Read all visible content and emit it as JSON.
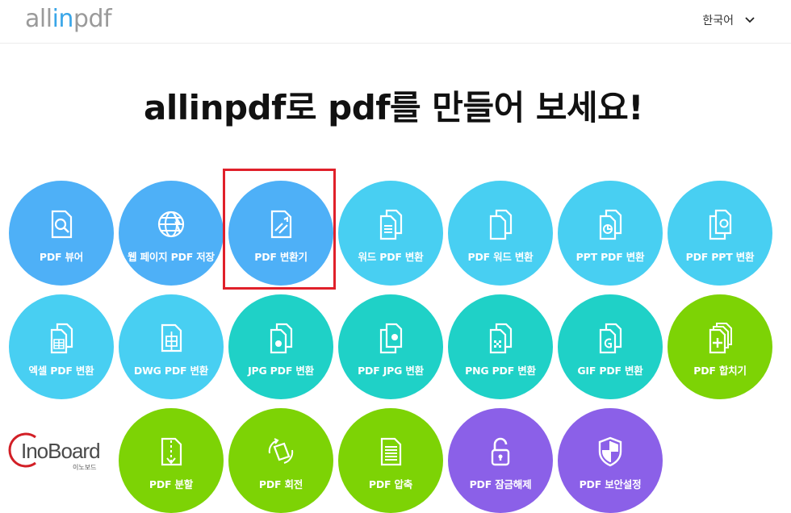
{
  "header": {
    "logo_prefix": "all",
    "logo_highlight": "in",
    "logo_suffix": "pdf",
    "language": "한국어",
    "language_icon": "chevron-down-icon"
  },
  "headline": "allinpdf로 pdf를 만들어 보세요!",
  "tools": [
    {
      "label": "PDF 뷰어",
      "icon": "pdf-viewer-icon",
      "color": "#4eb0f7"
    },
    {
      "label": "웹 페이지 PDF 저장",
      "icon": "globe-icon",
      "color": "#4eb0f7"
    },
    {
      "label": "PDF 변환기",
      "icon": "pdf-convert-icon",
      "color": "#4eb0f7"
    },
    {
      "label": "워드 PDF 변환",
      "icon": "word-doc-icon",
      "color": "#48cff2"
    },
    {
      "label": "PDF 워드 변환",
      "icon": "pdf-to-word-icon",
      "color": "#48cff2"
    },
    {
      "label": "PPT PDF 변환",
      "icon": "ppt-icon",
      "color": "#48cff2"
    },
    {
      "label": "PDF PPT 변환",
      "icon": "pdf-to-ppt-icon",
      "color": "#48cff2"
    },
    {
      "label": "엑셀 PDF 변환",
      "icon": "excel-icon",
      "color": "#48cff2"
    },
    {
      "label": "DWG PDF 변환",
      "icon": "dwg-icon",
      "color": "#48cff2"
    },
    {
      "label": "JPG PDF 변환",
      "icon": "jpg-icon",
      "color": "#1fd1c7"
    },
    {
      "label": "PDF JPG 변환",
      "icon": "pdf-to-jpg-icon",
      "color": "#1fd1c7"
    },
    {
      "label": "PNG PDF 변환",
      "icon": "png-icon",
      "color": "#1fd1c7"
    },
    {
      "label": "GIF PDF 변환",
      "icon": "gif-icon",
      "color": "#1fd1c7"
    },
    {
      "label": "PDF 합치기",
      "icon": "merge-icon",
      "color": "#7dd305"
    },
    {
      "label": "PDF 분할",
      "icon": "split-icon",
      "color": "#7dd305"
    },
    {
      "label": "PDF 회전",
      "icon": "rotate-icon",
      "color": "#7dd305"
    },
    {
      "label": "PDF 압축",
      "icon": "compress-icon",
      "color": "#7dd305"
    },
    {
      "label": "PDF 잠금해제",
      "icon": "unlock-icon",
      "color": "#8b60e8"
    },
    {
      "label": "PDF 보안설정",
      "icon": "shield-icon",
      "color": "#8b60e8"
    }
  ],
  "watermark": {
    "text": "InoBoard",
    "sub": "이노보드"
  }
}
